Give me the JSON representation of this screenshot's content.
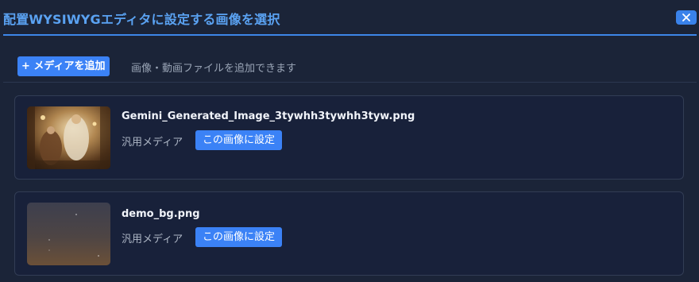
{
  "modal": {
    "title": "配置WYSIWYGエディタに設定する画像を選択",
    "close_icon": "close-icon"
  },
  "toolbar": {
    "add_media_label": "+ メディアを追加",
    "add_hint": "画像・動画ファイルを追加できます"
  },
  "media_items": [
    {
      "filename": "Gemini_Generated_Image_3tywhh3tywhh3tyw.png",
      "type": "汎用メディア",
      "set_button": "この画像に設定",
      "thumbnail": "ornate-golden-figures-image"
    },
    {
      "filename": "demo_bg.png",
      "type": "汎用メディア",
      "set_button": "この画像に設定",
      "thumbnail": "dusky-starry-gradient-image"
    }
  ],
  "colors": {
    "background": "#1b2438",
    "accent": "#3b82f6",
    "title": "#5aa2f2"
  }
}
